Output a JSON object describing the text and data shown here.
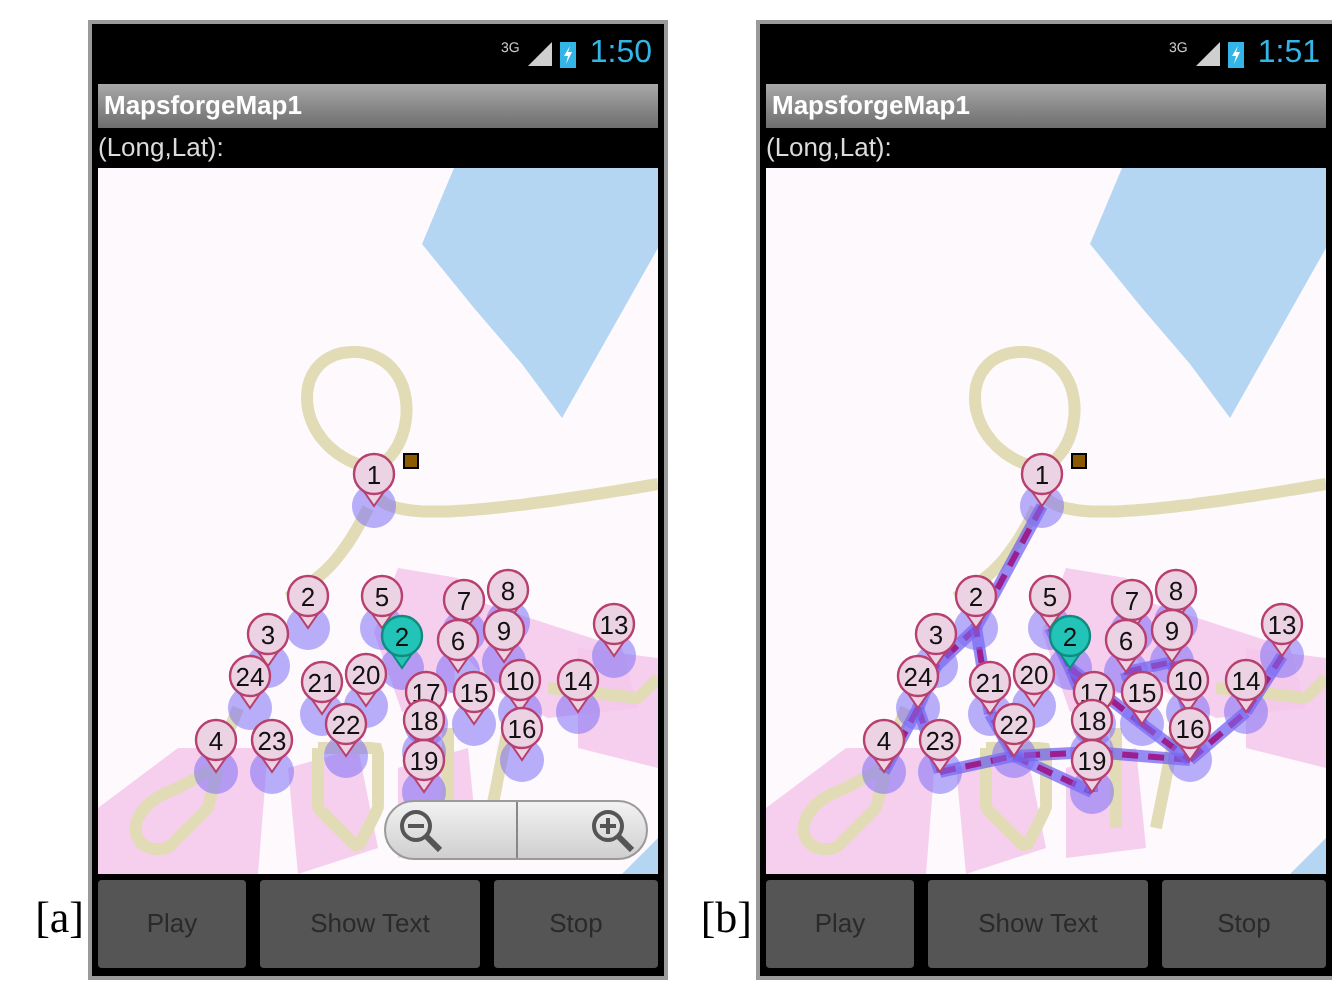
{
  "panels": [
    {
      "caption": "[a]",
      "status": {
        "network": "3G",
        "time": "1:50"
      },
      "title": "MapsforgeMap1",
      "coordinates": "(Long,Lat):",
      "route_shown": false,
      "zoom_controls": true,
      "markers": [
        {
          "label": "1",
          "kind": "stop"
        },
        {
          "label": "2",
          "kind": "stop"
        },
        {
          "label": "5",
          "kind": "stop"
        },
        {
          "label": "7",
          "kind": "stop"
        },
        {
          "label": "8",
          "kind": "stop"
        },
        {
          "label": "3",
          "kind": "stop"
        },
        {
          "label": "2",
          "kind": "current"
        },
        {
          "label": "6",
          "kind": "stop"
        },
        {
          "label": "9",
          "kind": "stop"
        },
        {
          "label": "13",
          "kind": "stop"
        },
        {
          "label": "24",
          "kind": "stop"
        },
        {
          "label": "21",
          "kind": "stop"
        },
        {
          "label": "20",
          "kind": "stop"
        },
        {
          "label": "17",
          "kind": "stop"
        },
        {
          "label": "15",
          "kind": "stop"
        },
        {
          "label": "10",
          "kind": "stop"
        },
        {
          "label": "14",
          "kind": "stop"
        },
        {
          "label": "4",
          "kind": "stop"
        },
        {
          "label": "23",
          "kind": "stop"
        },
        {
          "label": "22",
          "kind": "stop"
        },
        {
          "label": "18",
          "kind": "stop"
        },
        {
          "label": "16",
          "kind": "stop"
        },
        {
          "label": "19",
          "kind": "stop"
        }
      ],
      "buttons": [
        "Play",
        "Show Text",
        "Stop"
      ]
    },
    {
      "caption": "[b]",
      "status": {
        "network": "3G",
        "time": "1:51"
      },
      "title": "MapsforgeMap1",
      "coordinates": "(Long,Lat):",
      "route_shown": true,
      "zoom_controls": false,
      "markers": [
        {
          "label": "1",
          "kind": "stop"
        },
        {
          "label": "2",
          "kind": "stop"
        },
        {
          "label": "5",
          "kind": "stop"
        },
        {
          "label": "7",
          "kind": "stop"
        },
        {
          "label": "8",
          "kind": "stop"
        },
        {
          "label": "3",
          "kind": "stop"
        },
        {
          "label": "2",
          "kind": "current"
        },
        {
          "label": "6",
          "kind": "stop"
        },
        {
          "label": "9",
          "kind": "stop"
        },
        {
          "label": "13",
          "kind": "stop"
        },
        {
          "label": "24",
          "kind": "stop"
        },
        {
          "label": "21",
          "kind": "stop"
        },
        {
          "label": "20",
          "kind": "stop"
        },
        {
          "label": "17",
          "kind": "stop"
        },
        {
          "label": "15",
          "kind": "stop"
        },
        {
          "label": "10",
          "kind": "stop"
        },
        {
          "label": "14",
          "kind": "stop"
        },
        {
          "label": "4",
          "kind": "stop"
        },
        {
          "label": "23",
          "kind": "stop"
        },
        {
          "label": "22",
          "kind": "stop"
        },
        {
          "label": "18",
          "kind": "stop"
        },
        {
          "label": "16",
          "kind": "stop"
        },
        {
          "label": "19",
          "kind": "stop"
        }
      ],
      "buttons": [
        "Play",
        "Show Text",
        "Stop"
      ]
    }
  ]
}
